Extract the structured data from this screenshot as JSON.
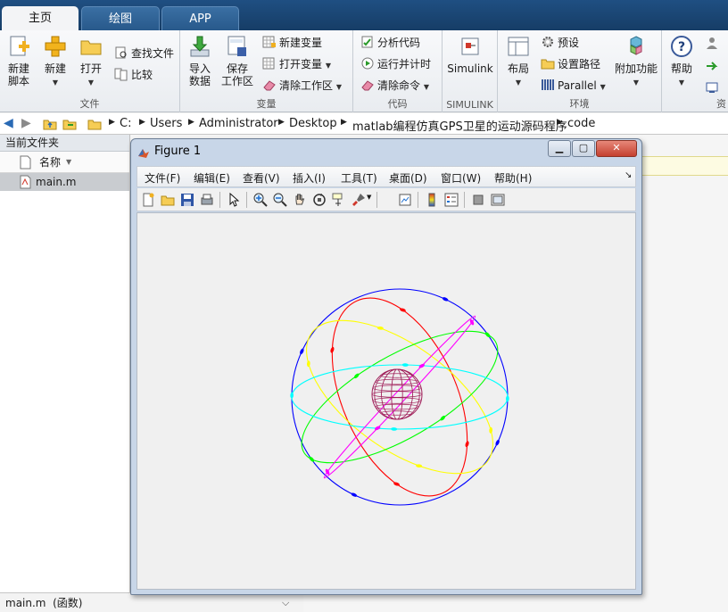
{
  "tabs": [
    {
      "label": "主页"
    },
    {
      "label": "绘图"
    },
    {
      "label": "APP"
    }
  ],
  "ribbon": {
    "file": {
      "label": "文件",
      "new_script": "新建\n脚本",
      "new": "新建",
      "open": "打开",
      "find_files": "查找文件",
      "compare": "比较"
    },
    "variable": {
      "label": "变量",
      "import": "导入\n数据",
      "save_ws": "保存\n工作区",
      "new_var": "新建变量",
      "open_var": "打开变量",
      "clear_ws": "清除工作区"
    },
    "code": {
      "label": "代码",
      "analyze": "分析代码",
      "run_time": "运行并计时",
      "clear_cmd": "清除命令"
    },
    "simulink": {
      "label": "SIMULINK",
      "button": "Simulink"
    },
    "env": {
      "label": "环境",
      "layout": "布局",
      "prefs": "预设",
      "set_path": "设置路径",
      "parallel": "Parallel",
      "addons": "附加功能"
    },
    "resources": {
      "label": "资",
      "help": "帮助"
    }
  },
  "address": {
    "crumbs": [
      "C:",
      "Users",
      "Administrator",
      "Desktop",
      "matlab编程仿真GPS卫星的运动源码程序",
      "code"
    ]
  },
  "file_panel": {
    "title": "当前文件夹",
    "column": "名称",
    "files": [
      {
        "name": "main.m"
      }
    ],
    "footer": "main.m  (函数)"
  },
  "figure": {
    "title": "Figure 1",
    "menu": [
      "文件(F)",
      "编辑(E)",
      "查看(V)",
      "插入(I)",
      "工具(T)",
      "桌面(D)",
      "窗口(W)",
      "帮助(H)"
    ],
    "orbit_colors": [
      "#0000ff",
      "#ff0000",
      "#ffff00",
      "#00ff00",
      "#00ffff",
      "#ff00ff"
    ],
    "earth_color": "#a0205a"
  }
}
